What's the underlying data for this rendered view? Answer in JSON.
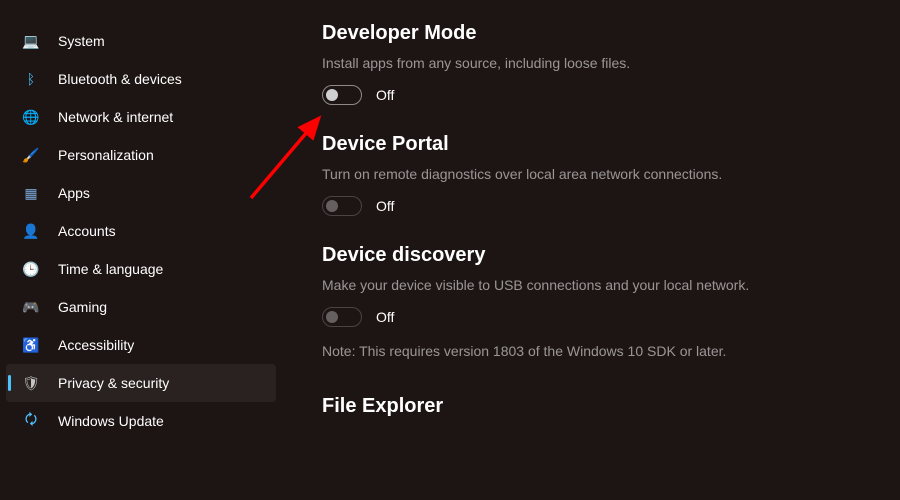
{
  "sidebar": {
    "items": [
      {
        "label": "System",
        "icon": "💻",
        "color": "#4cc2ff"
      },
      {
        "label": "Bluetooth & devices",
        "icon": "ᛒ",
        "color": "#4cc2ff"
      },
      {
        "label": "Network & internet",
        "icon": "🌐",
        "color": "#4cc2ff"
      },
      {
        "label": "Personalization",
        "icon": "🖌️",
        "color": "#e8b070"
      },
      {
        "label": "Apps",
        "icon": "▦",
        "color": "#7aa6d6"
      },
      {
        "label": "Accounts",
        "icon": "👤",
        "color": "#b89a7a"
      },
      {
        "label": "Time & language",
        "icon": "🕒",
        "color": "#4cc2ff"
      },
      {
        "label": "Gaming",
        "icon": "🎮",
        "color": "#c5c5c5"
      },
      {
        "label": "Accessibility",
        "icon": "♿",
        "color": "#4cc2ff"
      },
      {
        "label": "Privacy & security",
        "icon": "🛡",
        "color": "#c5c5c5"
      },
      {
        "label": "Windows Update",
        "icon": "🗘",
        "color": "#4cc2ff"
      }
    ],
    "selected_index": 9
  },
  "main": {
    "sections": [
      {
        "title": "Developer Mode",
        "desc": "Install apps from any source, including loose files.",
        "toggle_state": "Off",
        "enabled": true
      },
      {
        "title": "Device Portal",
        "desc": "Turn on remote diagnostics over local area network connections.",
        "toggle_state": "Off",
        "enabled": false
      },
      {
        "title": "Device discovery",
        "desc": "Make your device visible to USB connections and your local network.",
        "toggle_state": "Off",
        "enabled": false,
        "note": "Note: This requires version 1803 of the Windows 10 SDK or later."
      },
      {
        "title": "File Explorer"
      }
    ]
  },
  "annotation": {
    "color": "#ff0000"
  }
}
